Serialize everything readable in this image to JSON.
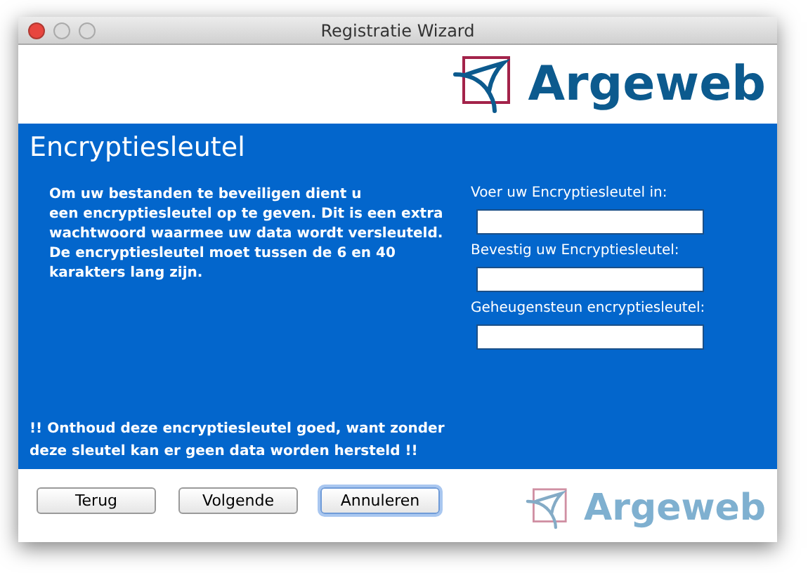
{
  "window": {
    "title": "Registratie Wizard"
  },
  "header": {
    "logo_text": "Argeweb"
  },
  "panel": {
    "title": "Encryptiesleutel",
    "intro": [
      "Om uw bestanden te beveiligen dient u",
      "een encryptiesleutel op te geven. Dit is een extra",
      "wachtwoord waarmee uw data wordt versleuteld.",
      "De encryptiesleutel moet tussen de 6 en 40",
      "karakters lang zijn."
    ],
    "fields": [
      {
        "label": "Voer uw Encryptiesleutel in:"
      },
      {
        "label": "Bevestig uw Encryptiesleutel:"
      },
      {
        "label": "Geheugensteun encryptiesleutel:"
      }
    ],
    "warning": [
      "!! Onthoud deze encryptiesleutel goed, want zonder",
      "deze sleutel kan er geen data worden hersteld !!"
    ]
  },
  "buttons": [
    {
      "label": "Terug",
      "focused": false
    },
    {
      "label": "Volgende",
      "focused": false
    },
    {
      "label": "Annuleren",
      "focused": true
    }
  ],
  "footer": {
    "logo_text": "Argeweb"
  }
}
